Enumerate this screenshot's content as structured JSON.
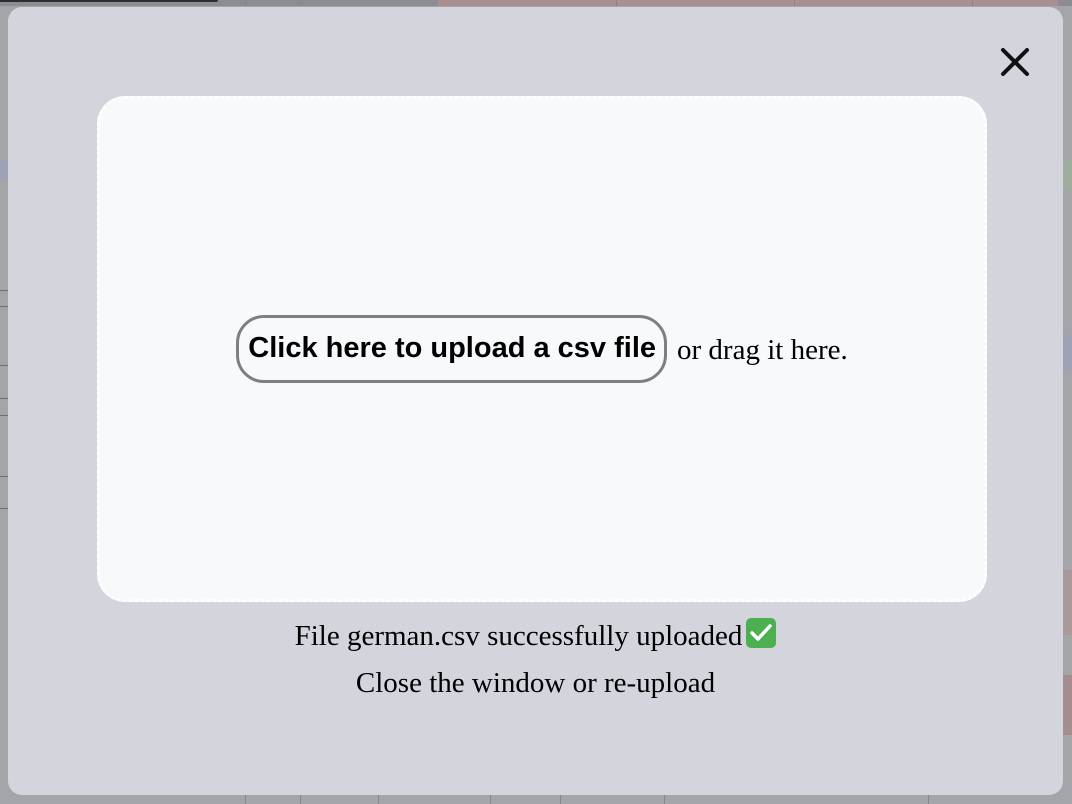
{
  "modal": {
    "upload_button_label": "Click here to upload a csv file",
    "drag_hint": "or drag it here.",
    "status_message": "File german.csv successfully uploaded",
    "status_hint": "Close the window or re-upload",
    "close_icon": "close-icon",
    "status_icon": "check-mark-icon"
  },
  "colors": {
    "overlay_panel": "#d4d5dc",
    "dropzone_fill": "#f8f9fb",
    "success_green": "#4caf50",
    "button_border": "#7f7f7f"
  }
}
